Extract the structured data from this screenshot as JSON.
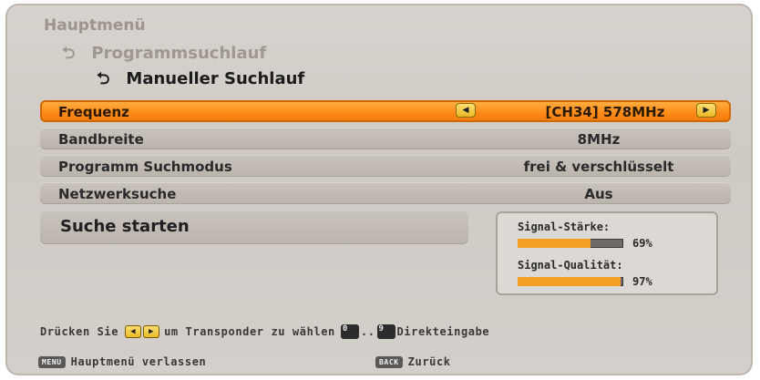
{
  "title": "Hauptmenü",
  "breadcrumbs": [
    {
      "label": "Programmsuchlauf"
    },
    {
      "label": "Manueller Suchlauf"
    }
  ],
  "rows": [
    {
      "label": "Frequenz",
      "value": "[CH34] 578MHz",
      "selected": true
    },
    {
      "label": "Bandbreite",
      "value": "8MHz"
    },
    {
      "label": "Programm Suchmodus",
      "value": "frei & verschlüsselt"
    },
    {
      "label": "Netzwerksuche",
      "value": "Aus"
    }
  ],
  "start_button": {
    "label": "Suche starten"
  },
  "signal": {
    "strength_label": "Signal-Stärke:",
    "strength_value": "69%",
    "strength_percent": 69,
    "quality_label": "Signal-Qualität:",
    "quality_value": "97%",
    "quality_percent": 97
  },
  "hint": {
    "prefix": "Drücken Sie",
    "middle": "um Transponder zu wählen",
    "between": "..",
    "suffix": "Direkteingabe",
    "key0": "0",
    "key9": "9"
  },
  "footer": {
    "menu_key": "MENU",
    "menu_label": "Hauptmenü verlassen",
    "back_key": "BACK",
    "back_label": "Zurück"
  },
  "icons": {
    "breadcrumb_arrow": "return-arrow-icon",
    "left": "left-arrow-icon",
    "right": "right-arrow-icon"
  },
  "colors": {
    "accent": "#ff8c1a",
    "bar_fill": "#f3a125"
  }
}
